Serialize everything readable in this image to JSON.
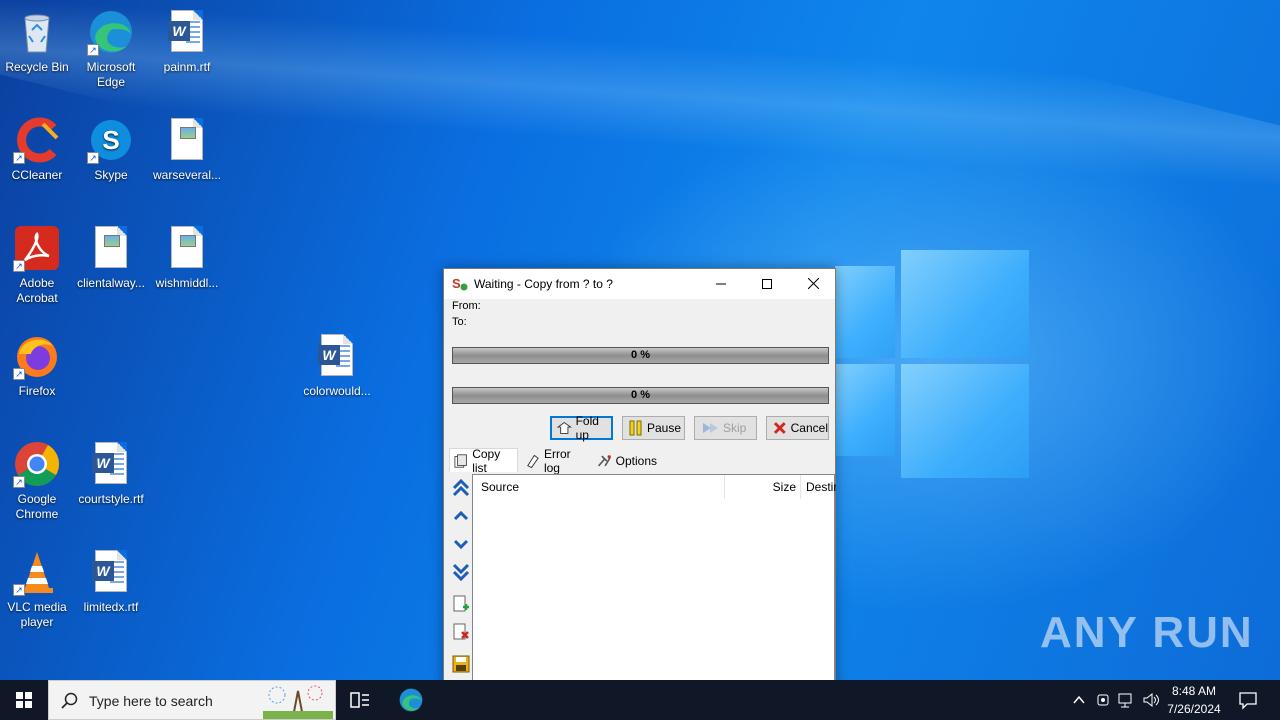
{
  "desktop": {
    "icons": [
      {
        "label": "Recycle Bin"
      },
      {
        "label": "Microsoft Edge"
      },
      {
        "label": "painm.rtf"
      },
      {
        "label": "CCleaner"
      },
      {
        "label": "Skype"
      },
      {
        "label": "warseveral..."
      },
      {
        "label": "Adobe Acrobat"
      },
      {
        "label": "clientalway..."
      },
      {
        "label": "wishmiddl..."
      },
      {
        "label": "colorwould..."
      },
      {
        "label": "Firefox"
      },
      {
        "label": "Google Chrome"
      },
      {
        "label": "courtstyle.rtf"
      },
      {
        "label": "VLC media player"
      },
      {
        "label": "limitedx.rtf"
      }
    ],
    "watermark": "ANY RUN"
  },
  "window": {
    "title": "Waiting - Copy from ? to ?",
    "from_label": "From:",
    "to_label": "To:",
    "progress_total": "0 %",
    "progress_file": "0 %",
    "progress_total_value": 0,
    "progress_file_value": 0,
    "buttons": {
      "fold_up": "Fold up",
      "pause": "Pause",
      "skip": "Skip",
      "cancel": "Cancel"
    },
    "tabs": {
      "copy_list": "Copy list",
      "error_log": "Error log",
      "options": "Options"
    },
    "columns": {
      "source": "Source",
      "size": "Size",
      "destination": "Destir"
    }
  },
  "taskbar": {
    "search_placeholder": "Type here to search",
    "time": "8:48 AM",
    "date": "7/26/2024"
  }
}
